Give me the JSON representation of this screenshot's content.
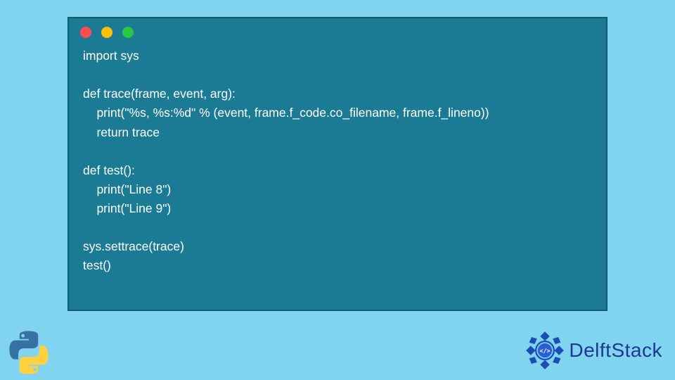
{
  "window": {
    "dots": [
      "red",
      "yellow",
      "green"
    ]
  },
  "code": {
    "lines": [
      "import sys",
      "",
      "def trace(frame, event, arg):",
      "    print(\"%s, %s:%d\" % (event, frame.f_code.co_filename, frame.f_lineno))",
      "    return trace",
      "",
      "def test():",
      "    print(\"Line 8\")",
      "    print(\"Line 9\")",
      "",
      "sys.settrace(trace)",
      "test()"
    ]
  },
  "brand": {
    "name": "DelftStack"
  },
  "colors": {
    "page_bg": "#81d4f0",
    "window_bg": "#1b7a94",
    "window_border": "#0d5c73",
    "code_text": "#ffffff",
    "brand_text": "#1a3a8f",
    "python_blue": "#3571a3",
    "python_yellow": "#ffd03f",
    "dot_red": "#ff4d4d",
    "dot_yellow": "#ffc107",
    "dot_green": "#28c840"
  }
}
